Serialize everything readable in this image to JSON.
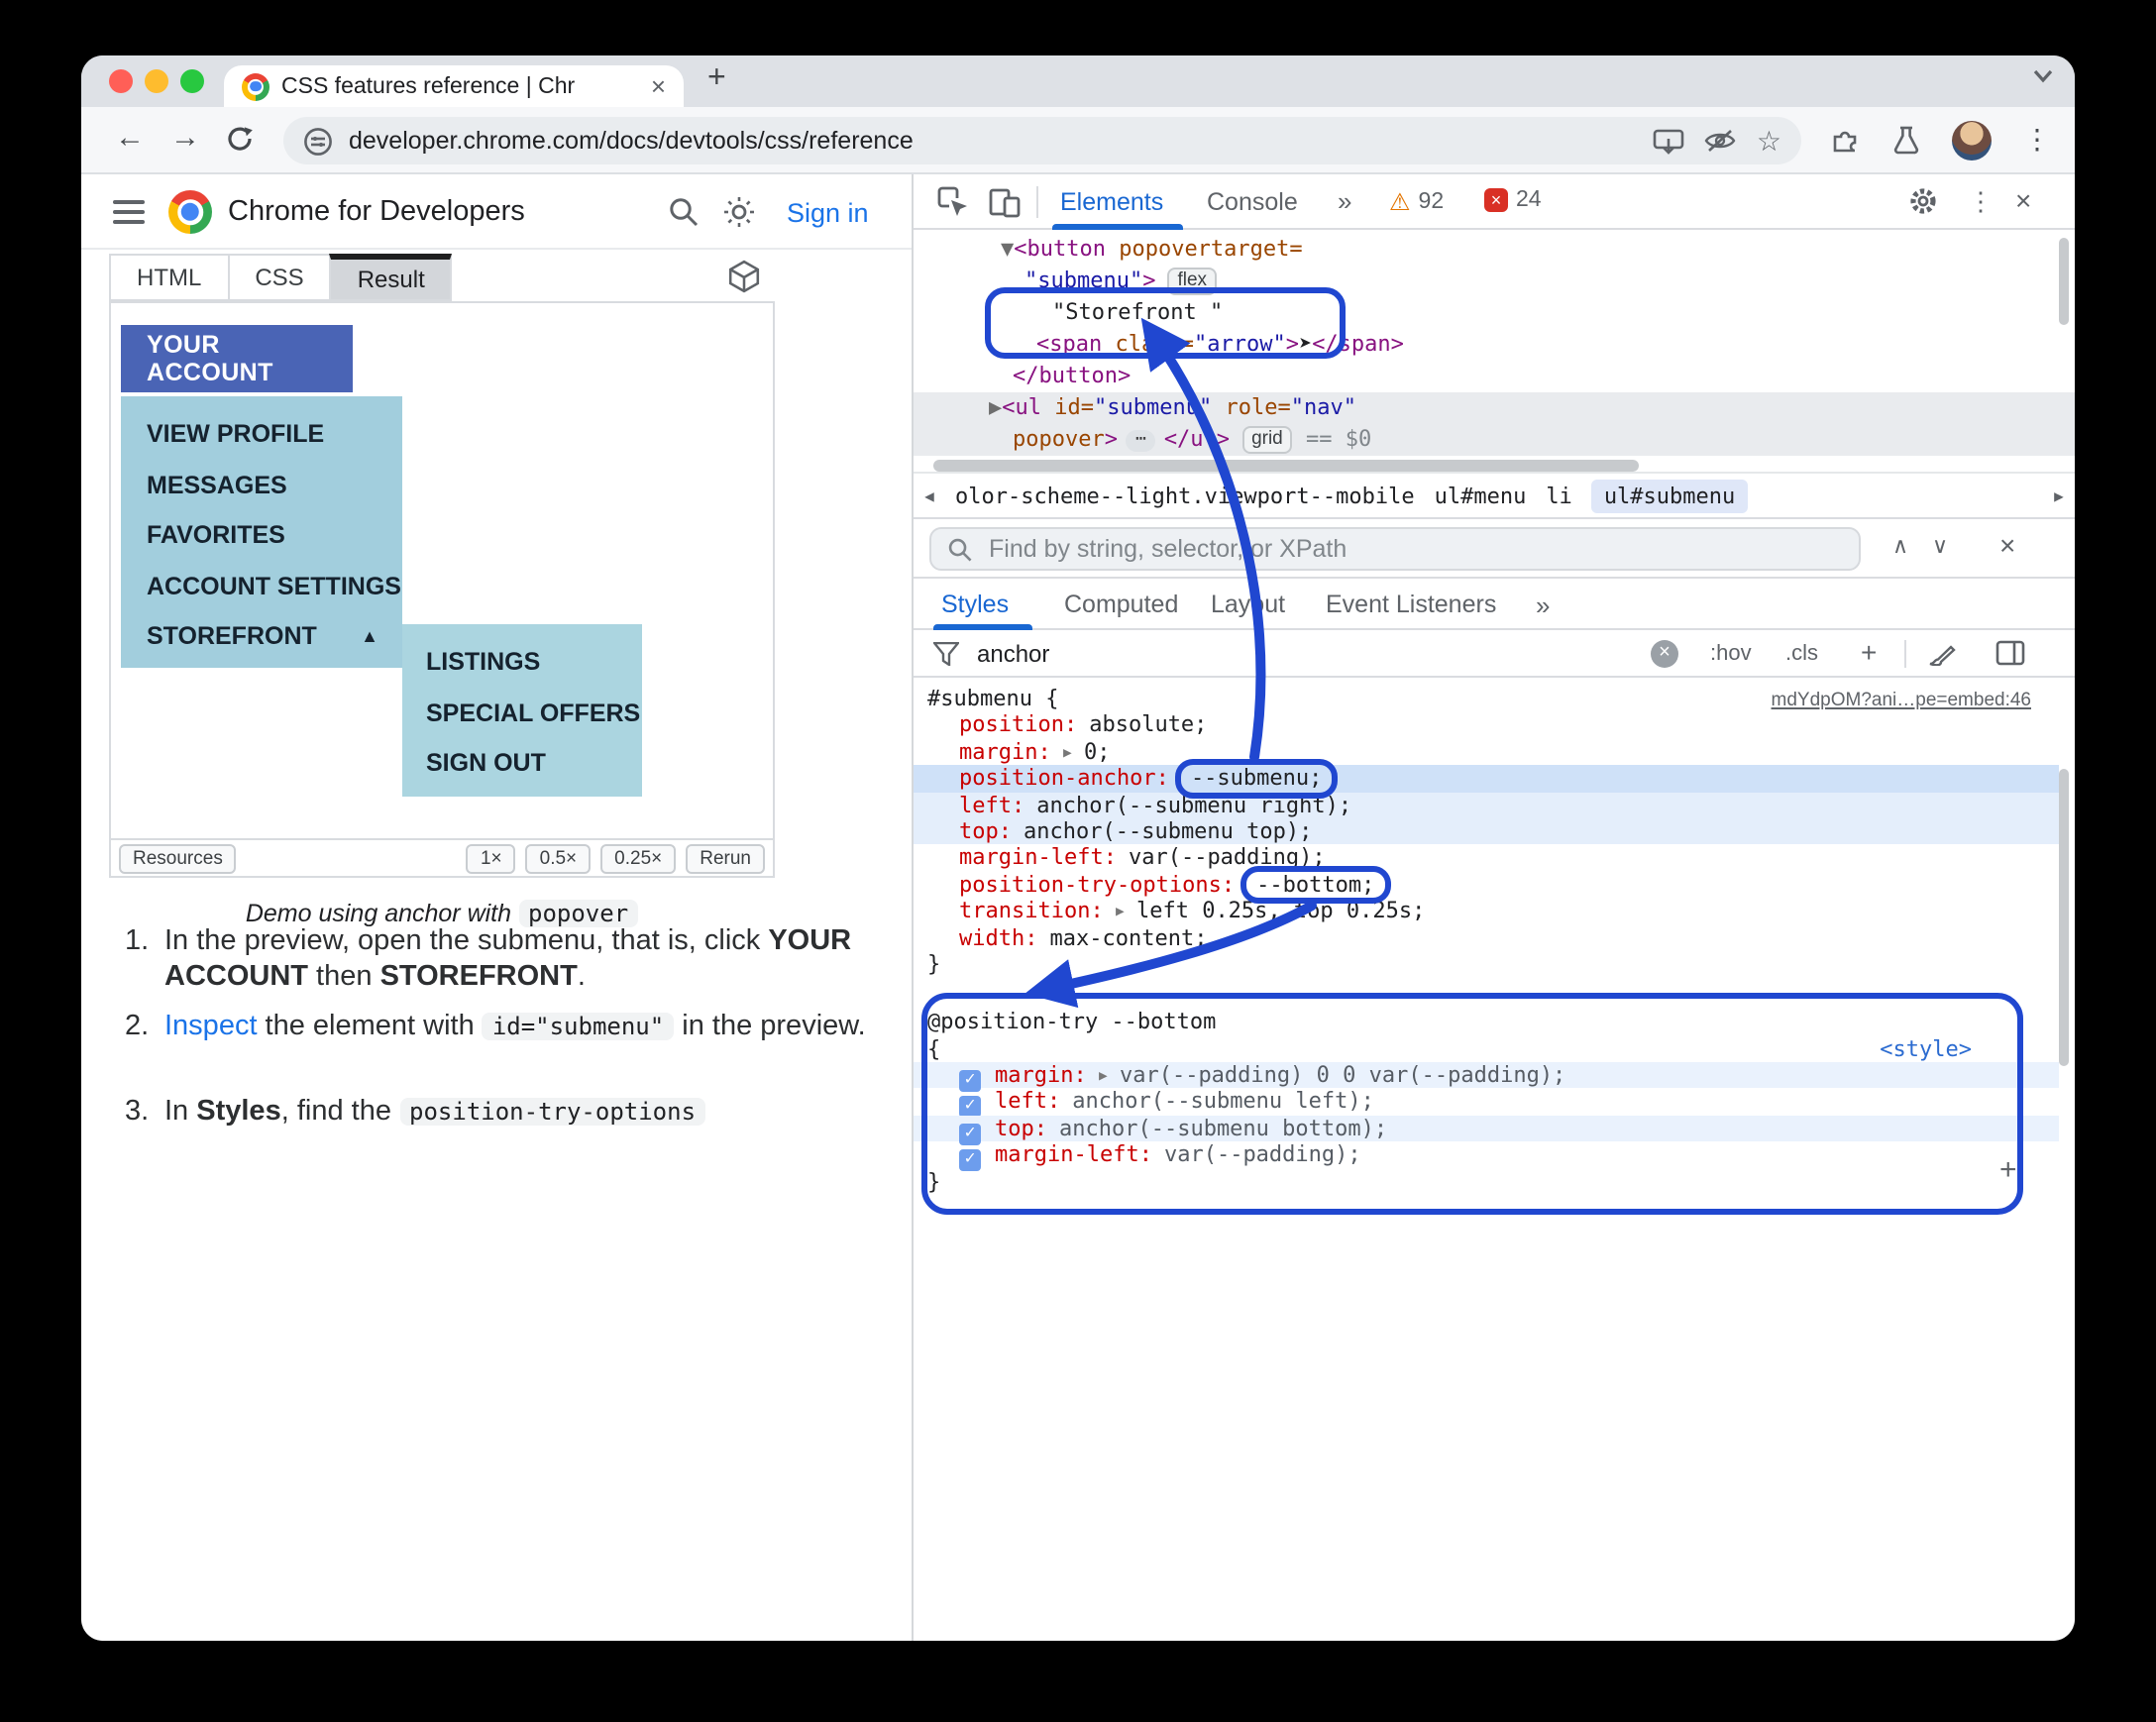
{
  "colors": {
    "annotation": "#2047d0",
    "link": "#1a73e8",
    "selected_tab": "#1967d2",
    "warning": "#e37400",
    "error": "#d93025",
    "account_button": "#4a64b5",
    "submenu_bg": "#a2cedd",
    "subsubmenu_bg": "#abd5e0"
  },
  "browser": {
    "tab_title": "CSS features reference  |  Chr",
    "url": "developer.chrome.com/docs/devtools/css/reference"
  },
  "site": {
    "title": "Chrome for Developers",
    "sign_in": "Sign in",
    "tabs": [
      "HTML",
      "CSS",
      "Result"
    ]
  },
  "demo": {
    "account": "YOUR ACCOUNT",
    "items": [
      "VIEW PROFILE",
      "MESSAGES",
      "FAVORITES",
      "ACCOUNT SETTINGS",
      "STOREFRONT"
    ],
    "expand_arrow": "▲",
    "sub_items": [
      "LISTINGS",
      "SPECIAL OFFERS",
      "SIGN OUT"
    ],
    "resources": "Resources",
    "scales": [
      "1×",
      "0.5×",
      "0.25×"
    ],
    "rerun": "Rerun",
    "caption": [
      {
        "c": "i",
        "s": "Demo using anchor with "
      },
      {
        "c": "code",
        "s": "popover"
      }
    ]
  },
  "steps": [
    {
      "num": "1.",
      "runs": [
        {
          "s": "In the preview, open the submenu, that is, click "
        },
        {
          "c": "b",
          "s": "YOUR ACCOUNT"
        },
        {
          "s": " then "
        },
        {
          "c": "b",
          "s": "STOREFRONT"
        },
        {
          "s": "."
        }
      ]
    },
    {
      "num": "2.",
      "runs": [
        {
          "c": "link",
          "s": "Inspect"
        },
        {
          "s": " the element with "
        },
        {
          "c": "code",
          "s": "id=\"submenu\""
        },
        {
          "s": " in the preview."
        }
      ]
    },
    {
      "num": "3.",
      "runs": [
        {
          "s": "In "
        },
        {
          "c": "b",
          "s": "Styles"
        },
        {
          "s": ", find the "
        },
        {
          "c": "code",
          "s": "position-try-options"
        }
      ]
    }
  ],
  "devtools": {
    "toolbar": {
      "elements": "Elements",
      "console": "Console",
      "more": "»",
      "warn_count": "92",
      "err_count": "24"
    },
    "tree": {
      "r1": [
        {
          "c": "exp",
          "s": "▼"
        },
        {
          "c": "tag",
          "s": "<button"
        },
        {
          "c": "attr",
          "s": " popovertarget="
        }
      ],
      "r2": [
        {
          "c": "val",
          "s": "\"submenu\""
        },
        {
          "c": "tag",
          "s": ">"
        }
      ],
      "badge_flex": "flex",
      "r3": [
        {
          "c": "txt",
          "s": "\"Storefront \""
        }
      ],
      "r4": [
        {
          "c": "tag",
          "s": "<span"
        },
        {
          "c": "attr",
          "s": " class="
        },
        {
          "c": "val",
          "s": "\"arrow\""
        },
        {
          "c": "tag",
          "s": ">"
        },
        {
          "c": "txt",
          "s": "➤"
        },
        {
          "c": "tag",
          "s": "</span>"
        }
      ],
      "r5": [
        {
          "c": "tag",
          "s": "</button>"
        }
      ],
      "r6": [
        {
          "c": "exp",
          "s": "▶"
        },
        {
          "c": "tag",
          "s": "<ul"
        },
        {
          "c": "attr",
          "s": " id="
        },
        {
          "c": "val",
          "s": "\"submenu\""
        },
        {
          "c": "attr",
          "s": " role="
        },
        {
          "c": "val",
          "s": "\"nav\""
        }
      ],
      "r7a": [
        {
          "c": "attr",
          "s": "popover"
        },
        {
          "c": "tag",
          "s": ">"
        }
      ],
      "dots": "⋯",
      "r7b": [
        {
          "c": "tag",
          "s": "</ul>"
        }
      ],
      "badge_grid": "grid",
      "r7c": [
        {
          "c": "eq",
          "s": " == $0"
        }
      ]
    },
    "crumbs": {
      "c1": "olor-scheme--light.viewport--mobile",
      "c2": "ul#menu",
      "c3": "li",
      "c4": "ul#submenu"
    },
    "find": {
      "placeholder": "Find by string, selector, or XPath"
    },
    "tabs": {
      "styles": "Styles",
      "computed": "Computed",
      "layout": "Layout",
      "events": "Event Listeners",
      "more": "»"
    },
    "filter": {
      "value": "anchor",
      "hov": ":hov",
      "cls": ".cls",
      "plus": "+"
    },
    "rule1": {
      "selector": "#submenu",
      "open": " {",
      "source": "mdYdpOM?ani…pe=embed:46",
      "props": [
        {
          "n": "position:",
          "v": "absolute;"
        },
        {
          "n": "margin:",
          "v": "0;"
        },
        {
          "n": "position-anchor:",
          "v": "--submenu;"
        },
        {
          "n": "left:",
          "v": "anchor(--submenu right);"
        },
        {
          "n": "top:",
          "v": "anchor(--submenu top);"
        },
        {
          "n": "margin-left:",
          "v": "var(--padding);"
        },
        {
          "n": "position-try-options:",
          "v": "--bottom;"
        },
        {
          "n": "transition:",
          "v": "left 0.25s, top 0.25s;"
        },
        {
          "n": "width:",
          "v": "max-content;"
        }
      ],
      "close": "}"
    },
    "atrule": {
      "header": "@position-try --bottom",
      "open": "{",
      "style_link": "<style>",
      "props": [
        {
          "n": "margin:",
          "v": "var(--padding) 0 0 var(--padding);"
        },
        {
          "n": "left:",
          "v": "anchor(--submenu left);"
        },
        {
          "n": "top:",
          "v": "anchor(--submenu bottom);"
        },
        {
          "n": "margin-left:",
          "v": "var(--padding);"
        }
      ],
      "close": "}",
      "add": "+"
    },
    "icons": {
      "expander": "▸",
      "check": "✓",
      "crumb_left": "◀",
      "crumb_right": "▶",
      "up": "∧",
      "down": "∨",
      "close": "×",
      "star": "☆",
      "back": "←",
      "forward": "→",
      "menu": "⋮",
      "warning": "⚠",
      "err_x": "×",
      "new_tab": "+"
    }
  }
}
